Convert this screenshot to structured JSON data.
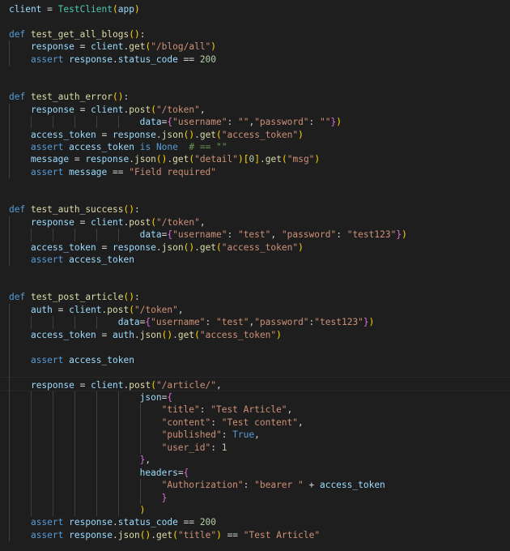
{
  "editor": {
    "language": "python",
    "theme": "dark",
    "colors": {
      "background": "#1e1e1e",
      "keyword": "#569cd6",
      "function": "#dcdcaa",
      "class": "#4ec9b0",
      "string": "#ce9178",
      "number": "#b5cea8",
      "variable": "#9cdcfe",
      "comment": "#6a9955",
      "bracket_level1": "#ffd700",
      "bracket_level2": "#da70d6",
      "bracket_level3": "#179fff"
    },
    "lines": [
      [
        [
          "var",
          "client"
        ],
        [
          "op",
          " = "
        ],
        [
          "cls",
          "TestClient"
        ],
        [
          "b1",
          "("
        ],
        [
          "var",
          "app"
        ],
        [
          "b1",
          ")"
        ]
      ],
      [],
      [
        [
          "kw",
          "def"
        ],
        [
          "op",
          " "
        ],
        [
          "fn",
          "test_get_all_blogs"
        ],
        [
          "b1",
          "()"
        ],
        [
          "op",
          ":"
        ]
      ],
      [
        [
          "op",
          "    "
        ],
        [
          "var",
          "response"
        ],
        [
          "op",
          " = "
        ],
        [
          "var",
          "client"
        ],
        [
          "op",
          "."
        ],
        [
          "fn",
          "get"
        ],
        [
          "b1",
          "("
        ],
        [
          "str",
          "\"/blog/all\""
        ],
        [
          "b1",
          ")"
        ]
      ],
      [
        [
          "op",
          "    "
        ],
        [
          "kw",
          "assert"
        ],
        [
          "op",
          " "
        ],
        [
          "var",
          "response"
        ],
        [
          "op",
          "."
        ],
        [
          "var",
          "status_code"
        ],
        [
          "op",
          " == "
        ],
        [
          "num",
          "200"
        ]
      ],
      [],
      [],
      [
        [
          "kw",
          "def"
        ],
        [
          "op",
          " "
        ],
        [
          "fn",
          "test_auth_error"
        ],
        [
          "b1",
          "()"
        ],
        [
          "op",
          ":"
        ]
      ],
      [
        [
          "op",
          "    "
        ],
        [
          "var",
          "response"
        ],
        [
          "op",
          " = "
        ],
        [
          "var",
          "client"
        ],
        [
          "op",
          "."
        ],
        [
          "fn",
          "post"
        ],
        [
          "b1",
          "("
        ],
        [
          "str",
          "\"/token\""
        ],
        [
          "op",
          ","
        ]
      ],
      [
        [
          "op",
          "                        "
        ],
        [
          "var",
          "data"
        ],
        [
          "op",
          "="
        ],
        [
          "b2",
          "{"
        ],
        [
          "str",
          "\"username\""
        ],
        [
          "op",
          ": "
        ],
        [
          "str",
          "\"\""
        ],
        [
          "op",
          ","
        ],
        [
          "str",
          "\"password\""
        ],
        [
          "op",
          ": "
        ],
        [
          "str",
          "\"\""
        ],
        [
          "b2",
          "}"
        ],
        [
          "b1",
          ")"
        ]
      ],
      [
        [
          "op",
          "    "
        ],
        [
          "var",
          "access_token"
        ],
        [
          "op",
          " = "
        ],
        [
          "var",
          "response"
        ],
        [
          "op",
          "."
        ],
        [
          "fn",
          "json"
        ],
        [
          "b1",
          "()"
        ],
        [
          "op",
          "."
        ],
        [
          "fn",
          "get"
        ],
        [
          "b1",
          "("
        ],
        [
          "str",
          "\"access_token\""
        ],
        [
          "b1",
          ")"
        ]
      ],
      [
        [
          "op",
          "    "
        ],
        [
          "kw",
          "assert"
        ],
        [
          "op",
          " "
        ],
        [
          "var",
          "access_token"
        ],
        [
          "op",
          " "
        ],
        [
          "kw",
          "is"
        ],
        [
          "op",
          " "
        ],
        [
          "kw",
          "None"
        ],
        [
          "op",
          "  "
        ],
        [
          "cmt",
          "# == \"\""
        ]
      ],
      [
        [
          "op",
          "    "
        ],
        [
          "var",
          "message"
        ],
        [
          "op",
          " = "
        ],
        [
          "var",
          "response"
        ],
        [
          "op",
          "."
        ],
        [
          "fn",
          "json"
        ],
        [
          "b1",
          "()"
        ],
        [
          "op",
          "."
        ],
        [
          "fn",
          "get"
        ],
        [
          "b1",
          "("
        ],
        [
          "str",
          "\"detail\""
        ],
        [
          "b1",
          ")"
        ],
        [
          "b1",
          "["
        ],
        [
          "num",
          "0"
        ],
        [
          "b1",
          "]"
        ],
        [
          "op",
          "."
        ],
        [
          "fn",
          "get"
        ],
        [
          "b1",
          "("
        ],
        [
          "str",
          "\"msg\""
        ],
        [
          "b1",
          ")"
        ]
      ],
      [
        [
          "op",
          "    "
        ],
        [
          "kw",
          "assert"
        ],
        [
          "op",
          " "
        ],
        [
          "var",
          "message"
        ],
        [
          "op",
          " == "
        ],
        [
          "str",
          "\"Field required\""
        ]
      ],
      [],
      [],
      [
        [
          "kw",
          "def"
        ],
        [
          "op",
          " "
        ],
        [
          "fn",
          "test_auth_success"
        ],
        [
          "b1",
          "()"
        ],
        [
          "op",
          ":"
        ]
      ],
      [
        [
          "op",
          "    "
        ],
        [
          "var",
          "response"
        ],
        [
          "op",
          " = "
        ],
        [
          "var",
          "client"
        ],
        [
          "op",
          "."
        ],
        [
          "fn",
          "post"
        ],
        [
          "b1",
          "("
        ],
        [
          "str",
          "\"/token\""
        ],
        [
          "op",
          ","
        ]
      ],
      [
        [
          "op",
          "                        "
        ],
        [
          "var",
          "data"
        ],
        [
          "op",
          "="
        ],
        [
          "b2",
          "{"
        ],
        [
          "str",
          "\"username\""
        ],
        [
          "op",
          ": "
        ],
        [
          "str",
          "\"test\""
        ],
        [
          "op",
          ", "
        ],
        [
          "str",
          "\"password\""
        ],
        [
          "op",
          ": "
        ],
        [
          "str",
          "\"test123\""
        ],
        [
          "b2",
          "}"
        ],
        [
          "b1",
          ")"
        ]
      ],
      [
        [
          "op",
          "    "
        ],
        [
          "var",
          "access_token"
        ],
        [
          "op",
          " = "
        ],
        [
          "var",
          "response"
        ],
        [
          "op",
          "."
        ],
        [
          "fn",
          "json"
        ],
        [
          "b1",
          "()"
        ],
        [
          "op",
          "."
        ],
        [
          "fn",
          "get"
        ],
        [
          "b1",
          "("
        ],
        [
          "str",
          "\"access_token\""
        ],
        [
          "b1",
          ")"
        ]
      ],
      [
        [
          "op",
          "    "
        ],
        [
          "kw",
          "assert"
        ],
        [
          "op",
          " "
        ],
        [
          "var",
          "access_token"
        ]
      ],
      [],
      [],
      [
        [
          "kw",
          "def"
        ],
        [
          "op",
          " "
        ],
        [
          "fn",
          "test_post_article"
        ],
        [
          "b1",
          "()"
        ],
        [
          "op",
          ":"
        ]
      ],
      [
        [
          "op",
          "    "
        ],
        [
          "var",
          "auth"
        ],
        [
          "op",
          " = "
        ],
        [
          "var",
          "client"
        ],
        [
          "op",
          "."
        ],
        [
          "fn",
          "post"
        ],
        [
          "b1",
          "("
        ],
        [
          "str",
          "\"/token\""
        ],
        [
          "op",
          ","
        ]
      ],
      [
        [
          "op",
          "                    "
        ],
        [
          "var",
          "data"
        ],
        [
          "op",
          "="
        ],
        [
          "b2",
          "{"
        ],
        [
          "str",
          "\"username\""
        ],
        [
          "op",
          ": "
        ],
        [
          "str",
          "\"test\""
        ],
        [
          "op",
          ","
        ],
        [
          "str",
          "\"password\""
        ],
        [
          "op",
          ":"
        ],
        [
          "str",
          "\"test123\""
        ],
        [
          "b2",
          "}"
        ],
        [
          "b1",
          ")"
        ]
      ],
      [
        [
          "op",
          "    "
        ],
        [
          "var",
          "access_token"
        ],
        [
          "op",
          " = "
        ],
        [
          "var",
          "auth"
        ],
        [
          "op",
          "."
        ],
        [
          "fn",
          "json"
        ],
        [
          "b1",
          "()"
        ],
        [
          "op",
          "."
        ],
        [
          "fn",
          "get"
        ],
        [
          "b1",
          "("
        ],
        [
          "str",
          "\"access_token\""
        ],
        [
          "b1",
          ")"
        ]
      ],
      [],
      [
        [
          "op",
          "    "
        ],
        [
          "kw",
          "assert"
        ],
        [
          "op",
          " "
        ],
        [
          "var",
          "access_token"
        ]
      ],
      [],
      [
        [
          "op",
          "    "
        ],
        [
          "var",
          "response"
        ],
        [
          "op",
          " = "
        ],
        [
          "var",
          "client"
        ],
        [
          "op",
          "."
        ],
        [
          "fn",
          "post"
        ],
        [
          "b1",
          "("
        ],
        [
          "str",
          "\"/article/\""
        ],
        [
          "op",
          ","
        ]
      ],
      [
        [
          "op",
          "                        "
        ],
        [
          "var",
          "json"
        ],
        [
          "op",
          "="
        ],
        [
          "b2",
          "{"
        ]
      ],
      [
        [
          "op",
          "                            "
        ],
        [
          "str",
          "\"title\""
        ],
        [
          "op",
          ": "
        ],
        [
          "str",
          "\"Test Article\""
        ],
        [
          "op",
          ","
        ]
      ],
      [
        [
          "op",
          "                            "
        ],
        [
          "str",
          "\"content\""
        ],
        [
          "op",
          ": "
        ],
        [
          "str",
          "\"Test content\""
        ],
        [
          "op",
          ","
        ]
      ],
      [
        [
          "op",
          "                            "
        ],
        [
          "str",
          "\"published\""
        ],
        [
          "op",
          ": "
        ],
        [
          "kw",
          "True"
        ],
        [
          "op",
          ","
        ]
      ],
      [
        [
          "op",
          "                            "
        ],
        [
          "str",
          "\"user_id\""
        ],
        [
          "op",
          ": "
        ],
        [
          "num",
          "1"
        ]
      ],
      [
        [
          "op",
          "                        "
        ],
        [
          "b2",
          "}"
        ],
        [
          "op",
          ","
        ]
      ],
      [
        [
          "op",
          "                        "
        ],
        [
          "var",
          "headers"
        ],
        [
          "op",
          "="
        ],
        [
          "b2",
          "{"
        ]
      ],
      [
        [
          "op",
          "                            "
        ],
        [
          "str",
          "\"Authorization\""
        ],
        [
          "op",
          ": "
        ],
        [
          "str",
          "\"bearer \""
        ],
        [
          "op",
          " + "
        ],
        [
          "var",
          "access_token"
        ]
      ],
      [
        [
          "op",
          "                            "
        ],
        [
          "b2",
          "}"
        ]
      ],
      [
        [
          "op",
          "                        "
        ],
        [
          "b1",
          ")"
        ]
      ],
      [
        [
          "op",
          "    "
        ],
        [
          "kw",
          "assert"
        ],
        [
          "op",
          " "
        ],
        [
          "var",
          "response"
        ],
        [
          "op",
          "."
        ],
        [
          "var",
          "status_code"
        ],
        [
          "op",
          " == "
        ],
        [
          "num",
          "200"
        ]
      ],
      [
        [
          "op",
          "    "
        ],
        [
          "kw",
          "assert"
        ],
        [
          "op",
          " "
        ],
        [
          "var",
          "response"
        ],
        [
          "op",
          "."
        ],
        [
          "fn",
          "json"
        ],
        [
          "b1",
          "()"
        ],
        [
          "op",
          "."
        ],
        [
          "fn",
          "get"
        ],
        [
          "b1",
          "("
        ],
        [
          "str",
          "\"title\""
        ],
        [
          "b1",
          ")"
        ],
        [
          "op",
          " == "
        ],
        [
          "str",
          "\"Test Article\""
        ]
      ]
    ]
  }
}
